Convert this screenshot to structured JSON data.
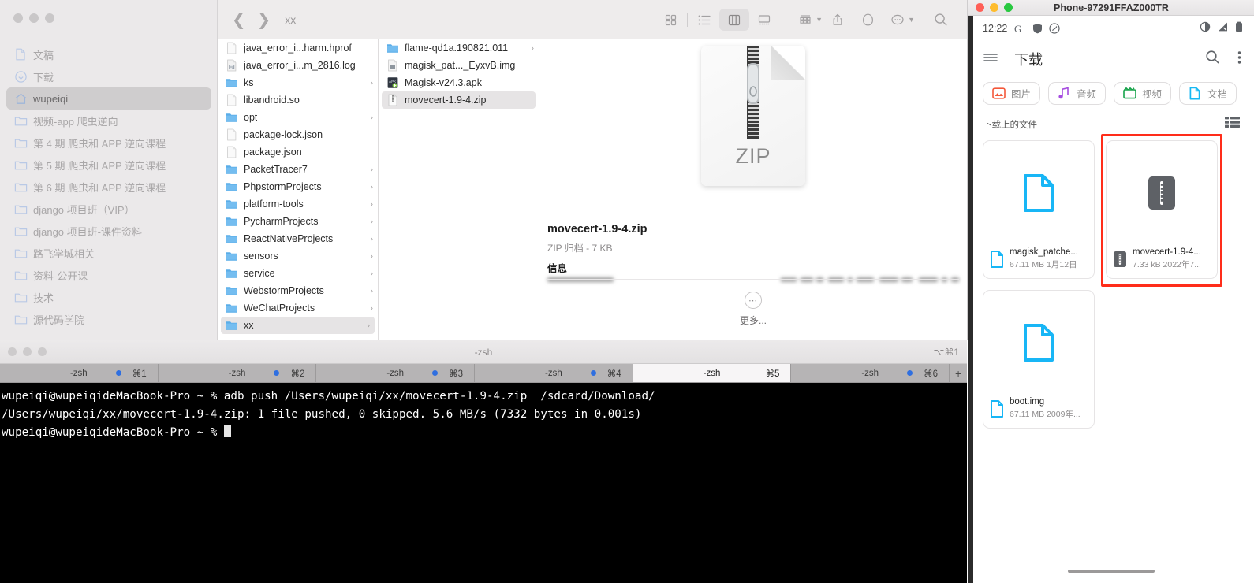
{
  "finder": {
    "window_name": "Finder",
    "toolbar": {
      "back_icon": "chevron-left-icon",
      "forward_icon": "chevron-right-icon",
      "path_title": "xx",
      "view_icon_grid": "grid-view-icon",
      "view_icon_list": "list-view-icon",
      "view_icon_column": "column-view-icon",
      "view_icon_gallery": "gallery-view-icon",
      "group_icon": "group-by-icon",
      "share_icon": "share-icon",
      "tag_icon": "tag-icon",
      "more_icon": "more-actions-icon",
      "search_icon": "search-icon"
    },
    "sidebar": [
      {
        "label": "文稿",
        "icon": "document-icon",
        "selected": false
      },
      {
        "label": "下载",
        "icon": "download-icon",
        "selected": false
      },
      {
        "label": "wupeiqi",
        "icon": "home-icon",
        "selected": true
      },
      {
        "label": "视频-app 爬虫逆向",
        "icon": "folder-icon",
        "selected": false
      },
      {
        "label": "第 4 期 爬虫和 APP 逆向课程",
        "icon": "folder-icon",
        "selected": false
      },
      {
        "label": "第 5 期 爬虫和 APP 逆向课程",
        "icon": "folder-icon",
        "selected": false
      },
      {
        "label": "第 6 期 爬虫和 APP 逆向课程",
        "icon": "folder-icon",
        "selected": false
      },
      {
        "label": "django 项目班（VIP）",
        "icon": "folder-icon",
        "selected": false
      },
      {
        "label": "django 项目班-课件资料",
        "icon": "folder-icon",
        "selected": false
      },
      {
        "label": "路飞学城相关",
        "icon": "folder-icon",
        "selected": false
      },
      {
        "label": "资料-公开课",
        "icon": "folder-icon",
        "selected": false
      },
      {
        "label": "技术",
        "icon": "folder-icon",
        "selected": false
      },
      {
        "label": "源代码学院",
        "icon": "folder-icon",
        "selected": false
      }
    ],
    "column1": [
      {
        "label": "java_error_i...harm.hprof",
        "kind": "file-blank",
        "arrow": false,
        "selected": false
      },
      {
        "label": "java_error_i...m_2816.log",
        "kind": "file-log",
        "arrow": false,
        "selected": false
      },
      {
        "label": "ks",
        "kind": "folder",
        "arrow": true,
        "selected": false
      },
      {
        "label": "libandroid.so",
        "kind": "file-blank",
        "arrow": false,
        "selected": false
      },
      {
        "label": "opt",
        "kind": "folder",
        "arrow": true,
        "selected": false
      },
      {
        "label": "package-lock.json",
        "kind": "file-blank",
        "arrow": false,
        "selected": false
      },
      {
        "label": "package.json",
        "kind": "file-blank",
        "arrow": false,
        "selected": false
      },
      {
        "label": "PacketTracer7",
        "kind": "folder",
        "arrow": true,
        "selected": false
      },
      {
        "label": "PhpstormProjects",
        "kind": "folder",
        "arrow": true,
        "selected": false
      },
      {
        "label": "platform-tools",
        "kind": "folder",
        "arrow": true,
        "selected": false
      },
      {
        "label": "PycharmProjects",
        "kind": "folder",
        "arrow": true,
        "selected": false
      },
      {
        "label": "ReactNativeProjects",
        "kind": "folder",
        "arrow": true,
        "selected": false
      },
      {
        "label": "sensors",
        "kind": "folder",
        "arrow": true,
        "selected": false
      },
      {
        "label": "service",
        "kind": "folder",
        "arrow": true,
        "selected": false
      },
      {
        "label": "WebstormProjects",
        "kind": "folder",
        "arrow": true,
        "selected": false
      },
      {
        "label": "WeChatProjects",
        "kind": "folder",
        "arrow": true,
        "selected": false
      },
      {
        "label": "xx",
        "kind": "folder",
        "arrow": true,
        "selected": true
      }
    ],
    "column2": [
      {
        "label": "flame-qd1a.190821.011",
        "kind": "folder",
        "arrow": true,
        "selected": false
      },
      {
        "label": "magisk_pat..._EyxvB.img",
        "kind": "file-img",
        "arrow": false,
        "selected": false
      },
      {
        "label": "Magisk-v24.3.apk",
        "kind": "file-apk",
        "arrow": false,
        "selected": false
      },
      {
        "label": "movecert-1.9-4.zip",
        "kind": "file-zip",
        "arrow": false,
        "selected": true
      }
    ],
    "preview": {
      "icon_label": "ZIP",
      "icon_name": "zip-archive-icon",
      "file_name": "movecert-1.9-4.zip",
      "file_kind": "ZIP 归档 - 7 KB",
      "info_heading": "信息",
      "more_label": "更多...",
      "more_icon": "ellipsis-circle-icon"
    }
  },
  "terminal": {
    "title": "-zsh",
    "title_shortcut": "⌥⌘1",
    "tabs": [
      {
        "label": "-zsh",
        "shortcut": "⌘1",
        "active": false,
        "dot": true
      },
      {
        "label": "-zsh",
        "shortcut": "⌘2",
        "active": false,
        "dot": true
      },
      {
        "label": "-zsh",
        "shortcut": "⌘3",
        "active": false,
        "dot": true
      },
      {
        "label": "-zsh",
        "shortcut": "⌘4",
        "active": false,
        "dot": true
      },
      {
        "label": "-zsh",
        "shortcut": "⌘5",
        "active": true,
        "dot": false
      },
      {
        "label": "-zsh",
        "shortcut": "⌘6",
        "active": false,
        "dot": true
      }
    ],
    "new_tab_label": "+",
    "lines": [
      "wupeiqi@wupeiqideMacBook-Pro ~ % adb push /Users/wupeiqi/xx/movecert-1.9-4.zip  /sdcard/Download/",
      "/Users/wupeiqi/xx/movecert-1.9-4.zip: 1 file pushed, 0 skipped. 5.6 MB/s (7332 bytes in 0.001s)",
      "wupeiqi@wupeiqideMacBook-Pro ~ % "
    ]
  },
  "phone": {
    "window_title": "Phone-97291FFAZ000TR",
    "traffic_colors": {
      "close": "#ff5f57",
      "minimize": "#febc2e",
      "zoom": "#28c840"
    },
    "status_bar": {
      "time": "12:22",
      "icons_left": [
        "google-icon",
        "shield-icon",
        "data-saver-icon"
      ],
      "icons_right": [
        "contrast-icon",
        "signal-icon",
        "battery-icon"
      ]
    },
    "app_bar": {
      "menu_icon": "hamburger-menu-icon",
      "title": "下载",
      "search_icon": "search-icon",
      "overflow_icon": "more-vertical-icon"
    },
    "chips": [
      {
        "label": "图片",
        "icon": "image-icon",
        "color": "#f4583a"
      },
      {
        "label": "音频",
        "icon": "audio-icon",
        "color": "#a64ce0"
      },
      {
        "label": "视频",
        "icon": "video-icon",
        "color": "#16a34a"
      },
      {
        "label": "文档",
        "icon": "document-icon",
        "color": "#16b8f3"
      }
    ],
    "section": {
      "label": "下载上的文件",
      "list_view_icon": "list-view-icon"
    },
    "files": [
      {
        "name": "magisk_patche...",
        "meta": "67.11 MB 1月12日",
        "icon": "file-blue-icon",
        "highlighted": false
      },
      {
        "name": "movecert-1.9-4...",
        "meta": "7.33 kB 2022年7...",
        "icon": "zip-gray-icon",
        "highlighted": true
      },
      {
        "name": "boot.img",
        "meta": "67.11 MB 2009年...",
        "icon": "file-blue-icon",
        "highlighted": false
      }
    ],
    "highlight_color": "#ff2d1a",
    "home_indicator": "home-indicator"
  }
}
